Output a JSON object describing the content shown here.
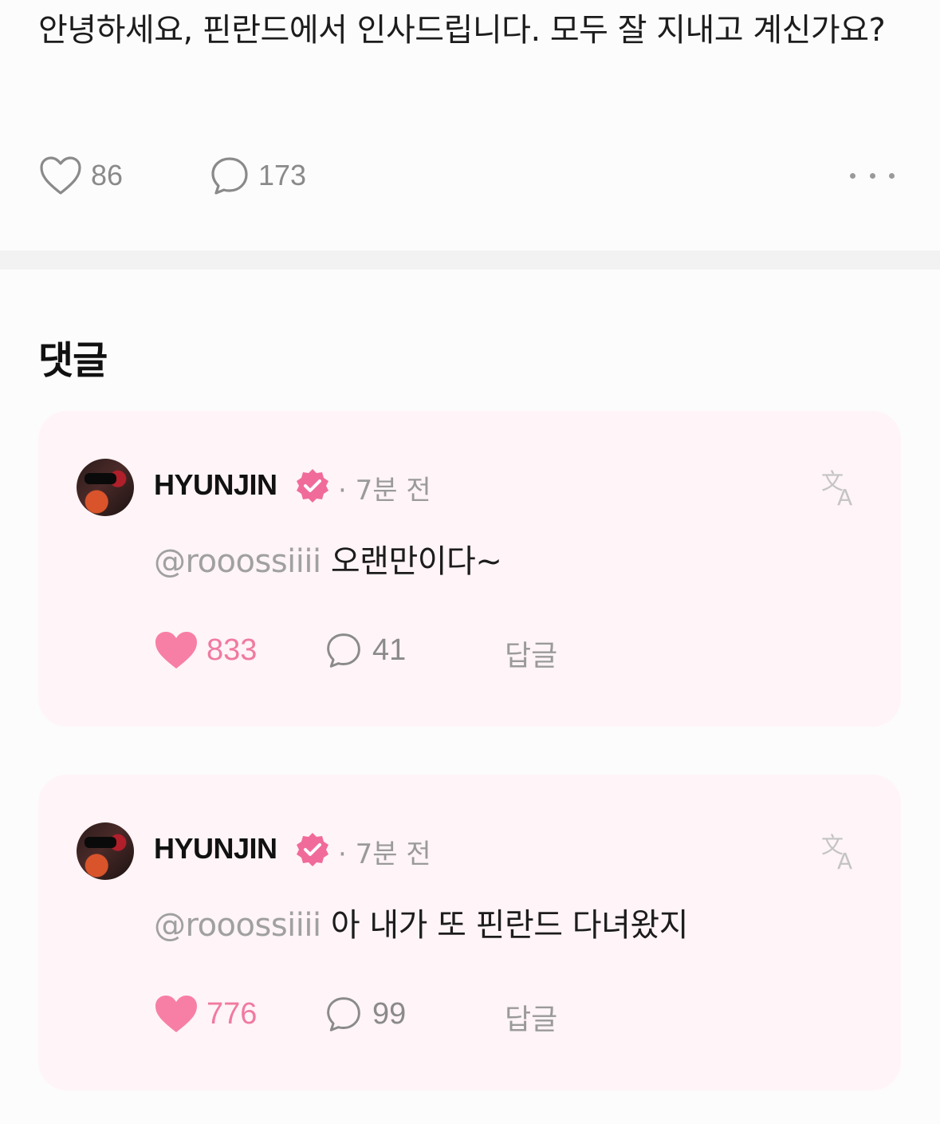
{
  "post": {
    "text": "안녕하세요, 핀란드에서 인사드립니다. 모두 잘 지내고 계신가요?",
    "likes": "86",
    "comments": "173"
  },
  "comments_section": {
    "title": "댓글"
  },
  "comments": [
    {
      "username": "HYUNJIN",
      "time": "· 7분 전",
      "mention": "@rooossiiii",
      "body": " 오랜만이다~",
      "likes": "833",
      "replies": "41",
      "reply_label": "답글"
    },
    {
      "username": "HYUNJIN",
      "time": "· 7분 전",
      "mention": "@rooossiiii",
      "body": " 아 내가 또 핀란드 다녀왔지",
      "likes": "776",
      "replies": "99",
      "reply_label": "답글"
    }
  ],
  "colors": {
    "accent_pink": "#f07aa0",
    "card_bg": "#fff4f7",
    "verified_badge": "#f06b9a"
  },
  "icons": {
    "post_like": "heart-outline-icon",
    "post_comment": "speech-bubble-icon",
    "more": "more-dots-icon",
    "verified": "verified-badge-icon",
    "translate": "translate-icon",
    "comment_like": "heart-filled-icon",
    "comment_reply": "speech-bubble-icon"
  }
}
